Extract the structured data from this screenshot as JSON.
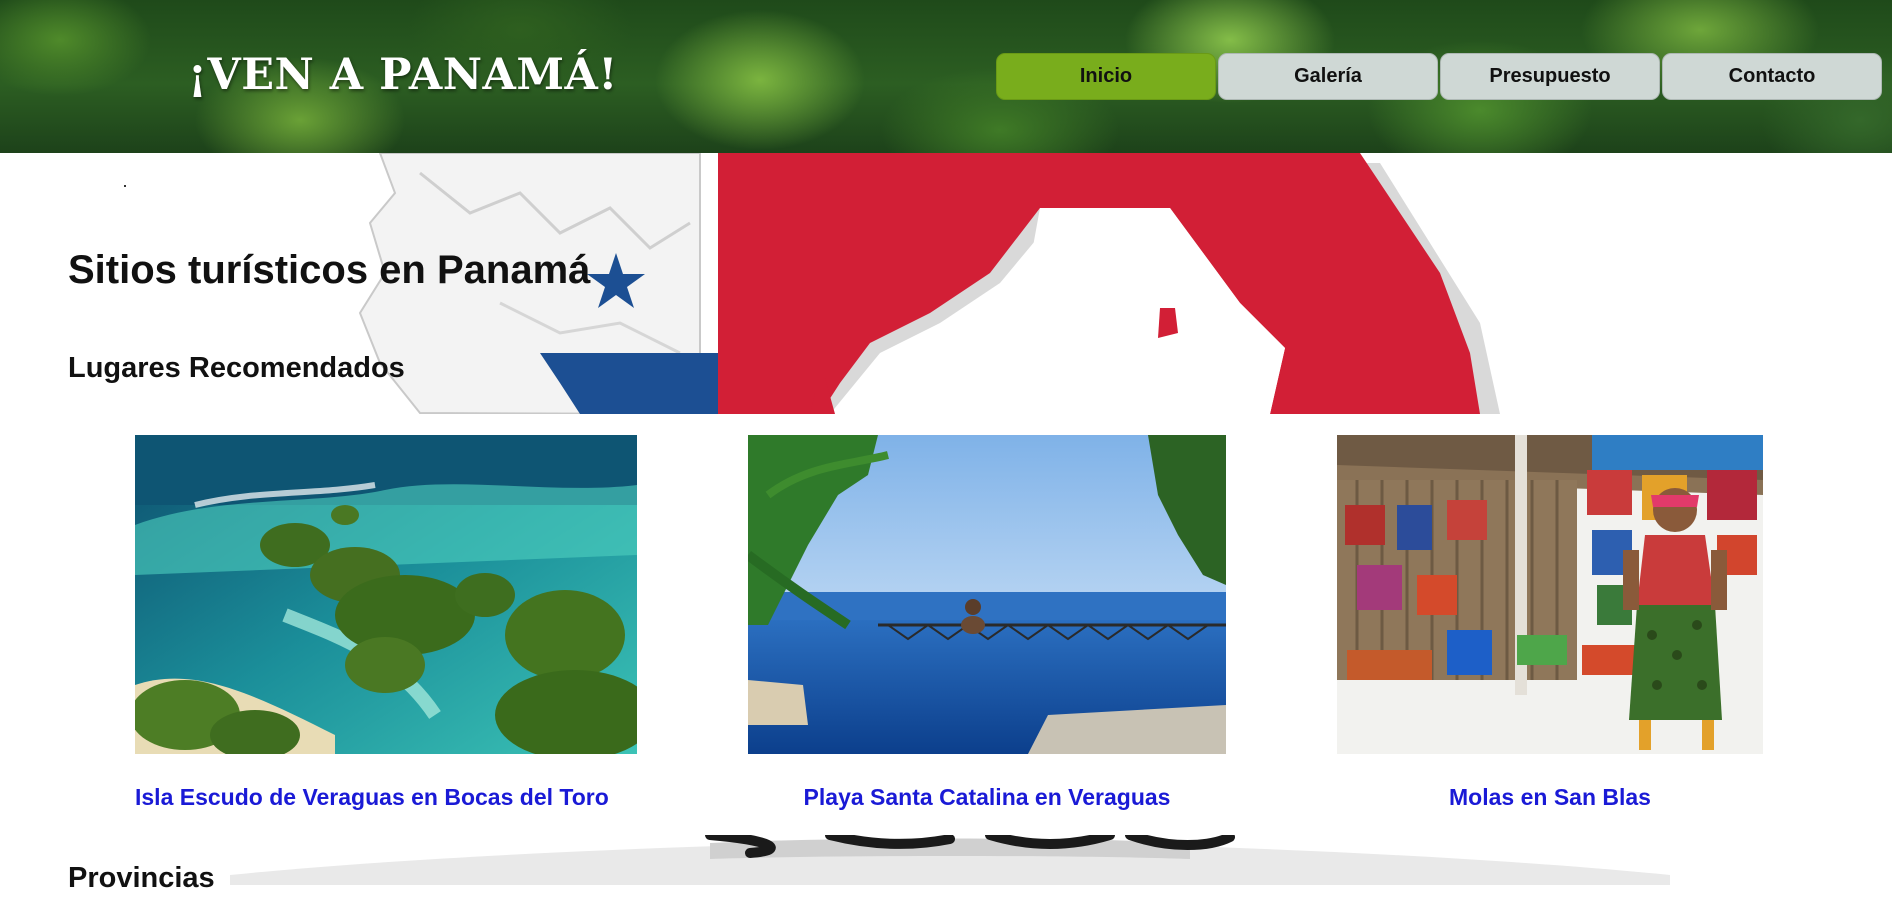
{
  "header": {
    "logo": "¡VEN A PANAMÁ!",
    "nav": [
      {
        "label": "Inicio",
        "active": true
      },
      {
        "label": "Galería",
        "active": false
      },
      {
        "label": "Presupuesto",
        "active": false
      },
      {
        "label": "Contacto",
        "active": false
      }
    ]
  },
  "main": {
    "title": "Sitios turísticos en Panamá",
    "recommended_heading": "Lugares Recomendados",
    "places": [
      {
        "caption": "Isla Escudo de Veraguas en Bocas del Toro",
        "image": "aerial-islands-photo"
      },
      {
        "caption": "Playa Santa Catalina en Veraguas",
        "image": "infinity-pool-photo"
      },
      {
        "caption": "Molas en San Blas",
        "image": "molas-market-photo"
      }
    ],
    "provinces_heading": "Provincias"
  },
  "colors": {
    "nav_active": "#79ad1c",
    "nav_inactive": "#cfd8d5",
    "link": "#1a1ad6",
    "flag_red": "#d21f36",
    "flag_blue": "#1c4f93"
  }
}
